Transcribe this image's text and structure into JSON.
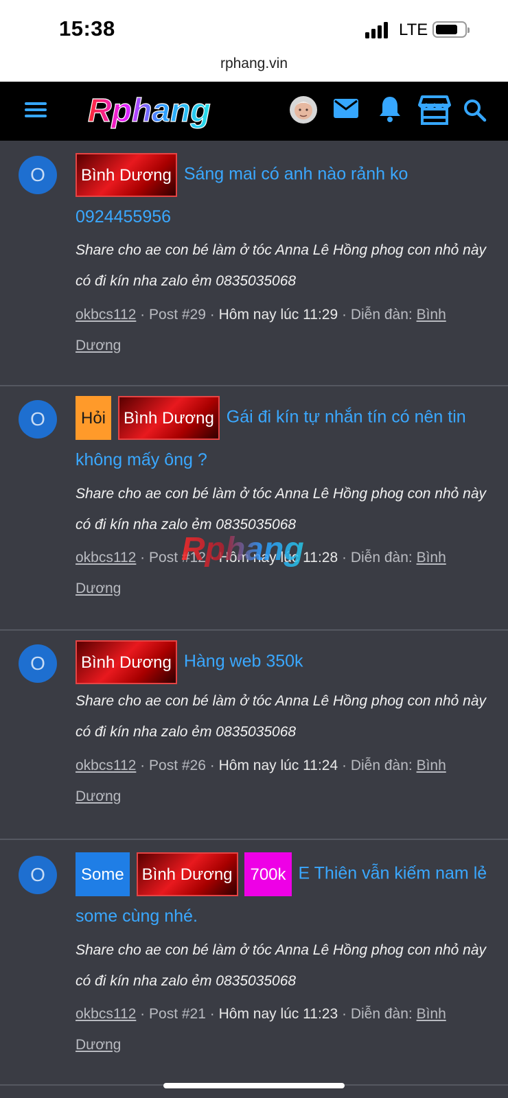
{
  "status_bar": {
    "time": "15:38",
    "network": "LTE"
  },
  "browser": {
    "url": "rphang.vin"
  },
  "header": {
    "logo_text": "Rphang",
    "icons": [
      "menu-icon",
      "avatar",
      "mail-icon",
      "bell-icon",
      "store-icon",
      "search-icon"
    ]
  },
  "posts": [
    {
      "avatar_letter": "O",
      "tags": [
        "Bình Dương"
      ],
      "title": "Sáng mai có anh nào rảnh ko 0924455956",
      "snippet": "Share cho ae con bé làm ở tóc Anna Lê Hồng phog con nhỏ này có đi kín nha zalo ẻm 0835035068",
      "user": "okbcs112",
      "post_no": "Post #29",
      "time": "Hôm nay lúc 11:29",
      "forum_label": "Diễn đàn:",
      "forum": "Bình Dương"
    },
    {
      "avatar_letter": "O",
      "tags": [
        "Hỏi",
        "Bình Dương"
      ],
      "title": "Gái đi kín tự nhắn tín có nên tin không mấy ông ?",
      "snippet": "Share cho ae con bé làm ở tóc Anna Lê Hồng phog con nhỏ này có đi kín nha zalo ẻm 0835035068",
      "user": "okbcs112",
      "post_no": "Post #12",
      "time": "Hôm nay lúc 11:28",
      "forum_label": "Diễn đàn:",
      "forum": "Bình Dương"
    },
    {
      "avatar_letter": "O",
      "tags": [
        "Bình Dương"
      ],
      "title": "Hàng web 350k",
      "snippet": "Share cho ae con bé làm ở tóc Anna Lê Hồng phog con nhỏ này có đi kín nha zalo ẻm 0835035068",
      "user": "okbcs112",
      "post_no": "Post #26",
      "time": "Hôm nay lúc 11:24",
      "forum_label": "Diễn đàn:",
      "forum": "Bình Dương"
    },
    {
      "avatar_letter": "O",
      "tags": [
        "Some",
        "Bình Dương",
        "700k"
      ],
      "title": "E Thiên vẫn kiếm nam lẻ some cùng nhé.",
      "snippet": "Share cho ae con bé làm ở tóc Anna Lê Hồng phog con nhỏ này có đi kín nha zalo ẻm 0835035068",
      "user": "okbcs112",
      "post_no": "Post #21",
      "time": "Hôm nay lúc 11:23",
      "forum_label": "Diễn đàn:",
      "forum": "Bình Dương"
    }
  ],
  "watermark_text": "Rphang",
  "colors": {
    "background": "#3a3c44",
    "link": "#3aa8ff",
    "nav": "#000000",
    "tag_region": "#e8191e",
    "tag_question": "#ff9a2a",
    "tag_some": "#1f7ee6",
    "tag_price": "#ee00e6"
  }
}
